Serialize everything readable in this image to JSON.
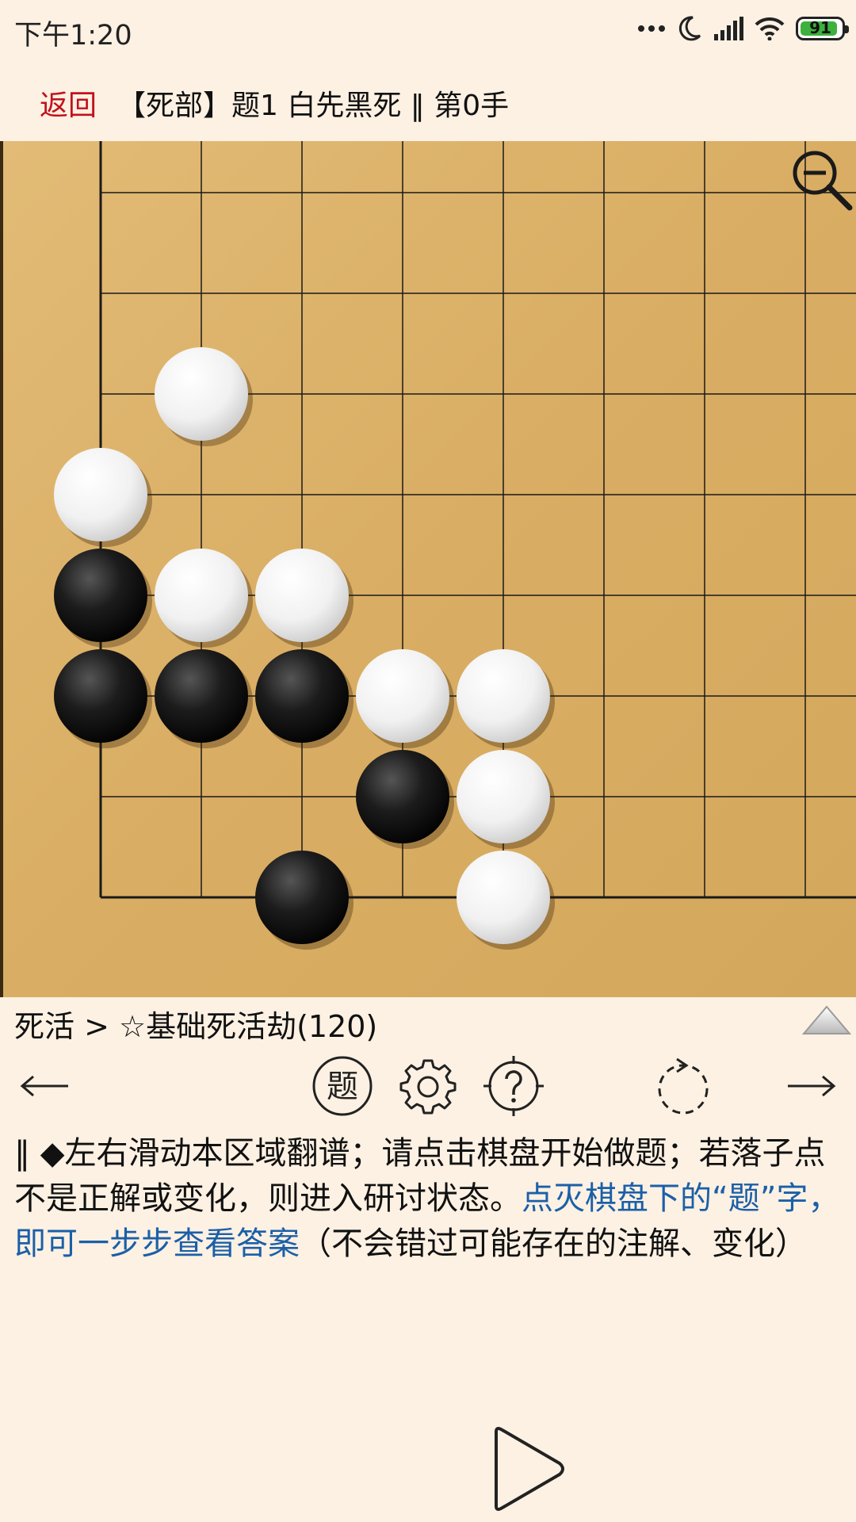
{
  "status_bar": {
    "time": "下午1:20",
    "battery_level": "91",
    "battery_fraction": 0.91
  },
  "header": {
    "back_label": "返回",
    "title": "【死部】题1 白先黑死 ‖ 第0手"
  },
  "board": {
    "grid_size": 19,
    "visible_lines": "top-left corner",
    "white_stones": [
      [
        2,
        3
      ],
      [
        1,
        4
      ],
      [
        2,
        5
      ],
      [
        3,
        5
      ],
      [
        4,
        6
      ],
      [
        5,
        6
      ],
      [
        5,
        7
      ],
      [
        5,
        8
      ]
    ],
    "black_stones": [
      [
        1,
        5
      ],
      [
        1,
        6
      ],
      [
        2,
        6
      ],
      [
        3,
        6
      ],
      [
        4,
        7
      ],
      [
        3,
        8
      ]
    ],
    "colors": {
      "wood": "#dcb26a",
      "line": "#1a1a1a"
    }
  },
  "breadcrumb": "死活 > ☆基础死活劫(120)",
  "toolbar": {
    "prev_arrow": "←",
    "next_arrow": "→",
    "answer_label": "题",
    "icons": [
      "left-arrow-icon",
      "answer-icon",
      "gear-icon",
      "hint-icon",
      "undo-icon",
      "right-arrow-icon"
    ]
  },
  "description": {
    "prefix": "‖      ◆左右滑动本区域翻谱；请点击棋盘开始做题；若落子点不是正解或变化，则进入研讨状态。",
    "highlight": "点灭棋盘下的“题”字，即可一步步查看答案",
    "suffix": "（不会错过可能存在的注解、变化）"
  },
  "colors": {
    "background": "#fdf1e3",
    "back_red": "#c1121c",
    "link_blue": "#1b5fa8"
  }
}
